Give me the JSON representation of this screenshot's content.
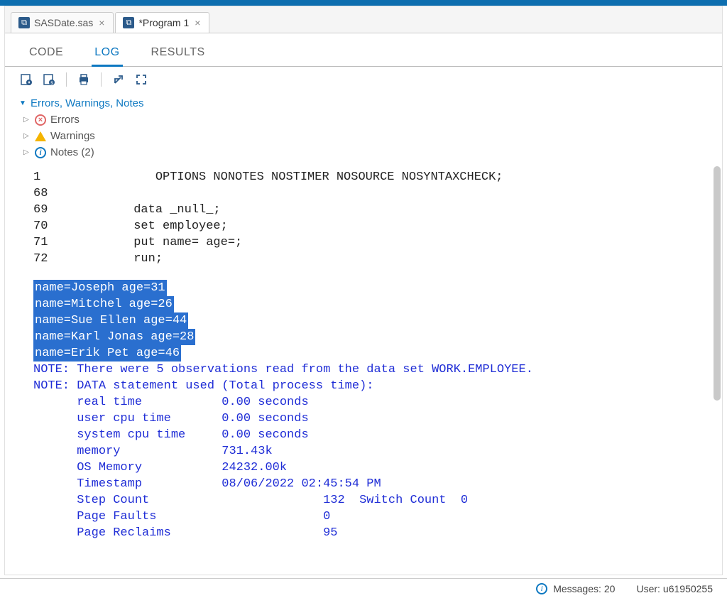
{
  "file_tabs": [
    {
      "label": "SASDate.sas",
      "dirty": false,
      "active": false
    },
    {
      "label": "*Program 1",
      "dirty": true,
      "active": true
    }
  ],
  "view_tabs": {
    "code": "CODE",
    "log": "LOG",
    "results": "RESULTS",
    "active": "log"
  },
  "tree": {
    "title": "Errors, Warnings, Notes",
    "errors_label": "Errors",
    "warnings_label": "Warnings",
    "notes_label": "Notes (2)"
  },
  "log": {
    "code_lines": [
      {
        "num": "1",
        "text": "OPTIONS NONOTES NOSTIMER NOSOURCE NOSYNTAXCHECK;"
      },
      {
        "num": "68",
        "text": ""
      },
      {
        "num": "69",
        "text": "data _null_;"
      },
      {
        "num": "70",
        "text": "set employee;"
      },
      {
        "num": "71",
        "text": "put name= age=;"
      },
      {
        "num": "72",
        "text": "run;"
      }
    ],
    "put_output": [
      "name=Joseph age=31",
      "name=Mitchel age=26",
      "name=Sue Ellen age=44",
      "name=Karl Jonas age=28",
      "name=Erik Pet age=46"
    ],
    "notes": [
      "NOTE: There were 5 observations read from the data set WORK.EMPLOYEE.",
      "NOTE: DATA statement used (Total process time):",
      "      real time           0.00 seconds",
      "      user cpu time       0.00 seconds",
      "      system cpu time     0.00 seconds",
      "      memory              731.43k",
      "      OS Memory           24232.00k",
      "      Timestamp           08/06/2022 02:45:54 PM",
      "      Step Count                        132  Switch Count  0",
      "      Page Faults                       0",
      "      Page Reclaims                     95"
    ]
  },
  "statusbar": {
    "messages_label": "Messages:",
    "messages_count": "20",
    "user_label": "User:",
    "user_value": "u61950255"
  }
}
